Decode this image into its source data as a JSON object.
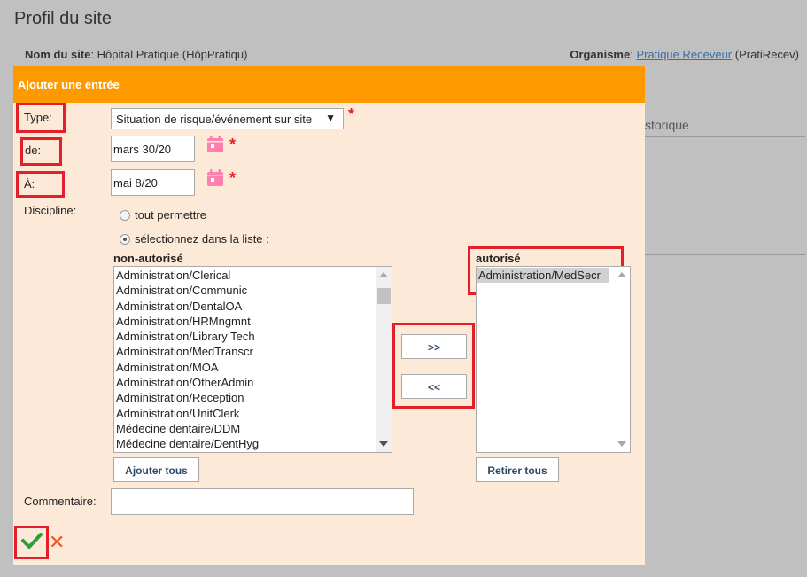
{
  "page": {
    "title": "Profil du site",
    "site_label": "Nom du site",
    "site_value": ": Hôpital Pratique (HôpPratiqu)",
    "org_label": "Organisme",
    "org_sep": ": ",
    "org_link": "Pratique Receveur",
    "org_code": " (PratiRecev)",
    "bg_tab": "storique"
  },
  "dialog": {
    "title": "Ajouter une entrée",
    "type_label": "Type:",
    "type_value": "Situation de risque/événement sur site",
    "from_label": "de:",
    "from_value": "mars 30/20",
    "to_label": "À:",
    "to_value": "mai 8/20",
    "required_mark": "*",
    "discipline_label": "Discipline:",
    "radio_all": "tout permettre",
    "radio_select": "sélectionnez dans la liste :",
    "not_allowed_title": "non-autorisé",
    "allowed_title": "autorisé",
    "not_allowed_items": [
      "Administration/Clerical",
      "Administration/Communic",
      "Administration/DentalOA",
      "Administration/HRMngmnt",
      "Administration/Library Tech",
      "Administration/MedTranscr",
      "Administration/MOA",
      "Administration/OtherAdmin",
      "Administration/Reception",
      "Administration/UnitClerk",
      "Médecine dentaire/DDM",
      "Médecine dentaire/DentHyg"
    ],
    "allowed_items": [
      "Administration/MedSecr"
    ],
    "add_button": ">>",
    "remove_button": "<<",
    "add_all_button": "Ajouter tous",
    "remove_all_button": "Retirer tous",
    "comment_label": "Commentaire:",
    "comment_value": ""
  },
  "colors": {
    "header": "#ff9900",
    "dialog_bg": "#fde9d8",
    "highlight": "#e3202a",
    "confirm": "#2e9e3a",
    "cancel": "#e8572a"
  }
}
